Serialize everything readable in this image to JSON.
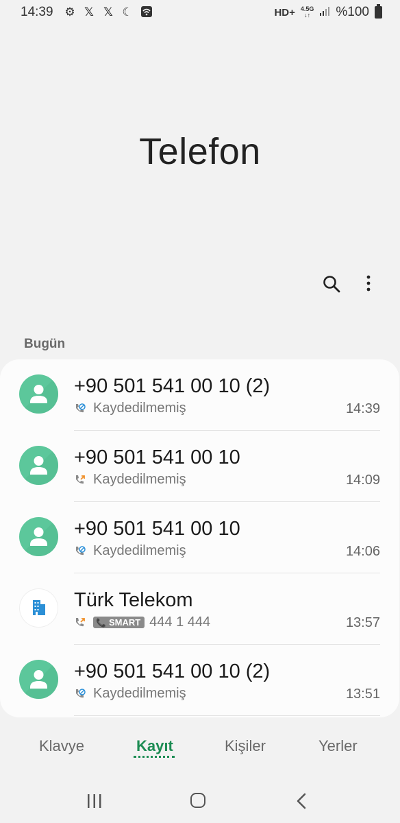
{
  "status_bar": {
    "time": "14:39",
    "left_icons": [
      "gear-icon",
      "x-icon",
      "x-icon",
      "moon-icon",
      "wifi-icon"
    ],
    "network_type": "HD+",
    "network_gen": "4.5G",
    "battery": "%100"
  },
  "header": {
    "title": "Telefon"
  },
  "toolbar": {
    "icons": [
      "search-icon",
      "more-icon"
    ]
  },
  "section": {
    "label": "Bugün"
  },
  "calls": [
    {
      "name": "+90 501 541 00 10 (2)",
      "sub": "Kaydedilmemiş",
      "time": "14:39",
      "call_type": "missed-blocked",
      "avatar": "person"
    },
    {
      "name": "+90 501 541 00 10",
      "sub": "Kaydedilmemiş",
      "time": "14:09",
      "call_type": "outgoing",
      "avatar": "person"
    },
    {
      "name": "+90 501 541 00 10",
      "sub": "Kaydedilmemiş",
      "time": "14:06",
      "call_type": "missed-blocked",
      "avatar": "person"
    },
    {
      "name": "Türk Telekom",
      "badge": "SMART",
      "sub": "444 1 444",
      "time": "13:57",
      "call_type": "outgoing",
      "avatar": "business"
    },
    {
      "name": "+90 501 541 00 10 (2)",
      "sub": "Kaydedilmemiş",
      "time": "13:51",
      "call_type": "missed-blocked",
      "avatar": "person"
    }
  ],
  "tabs": [
    {
      "label": "Klavye",
      "active": false
    },
    {
      "label": "Kayıt",
      "active": true
    },
    {
      "label": "Kişiler",
      "active": false
    },
    {
      "label": "Yerler",
      "active": false
    }
  ],
  "colors": {
    "accent": "#1c8c53",
    "avatar": "#5cc79b",
    "business_icon": "#2b8fd6"
  }
}
